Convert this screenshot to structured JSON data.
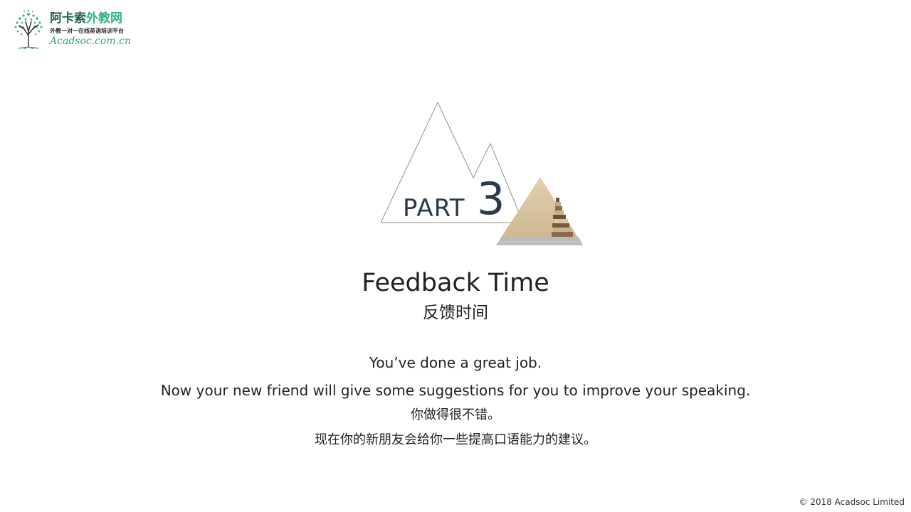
{
  "logo": {
    "name_part1": "阿卡索",
    "name_part2": "外教网",
    "tagline": "外教一对一在线英语培训平台",
    "url": "Acadsoc.com.cn"
  },
  "section": {
    "part_label": "PART",
    "part_number": "3"
  },
  "heading": {
    "title_en": "Feedback Time",
    "title_cn": "反馈时间"
  },
  "body": {
    "line_en_1": "You’ve done a great job.",
    "line_en_2": "Now your new friend will give some suggestions for you to improve your speaking.",
    "line_cn_1": "你做得很不错。",
    "line_cn_2": "现在你的新朋友会给你一些提高口语能力的建议。"
  },
  "footer": {
    "copyright": "© 2018 Acadsoc Limited"
  },
  "colors": {
    "brand_dark": "#1f5f4a",
    "brand_green": "#2fb08a",
    "part_text": "#2b3a4a"
  }
}
